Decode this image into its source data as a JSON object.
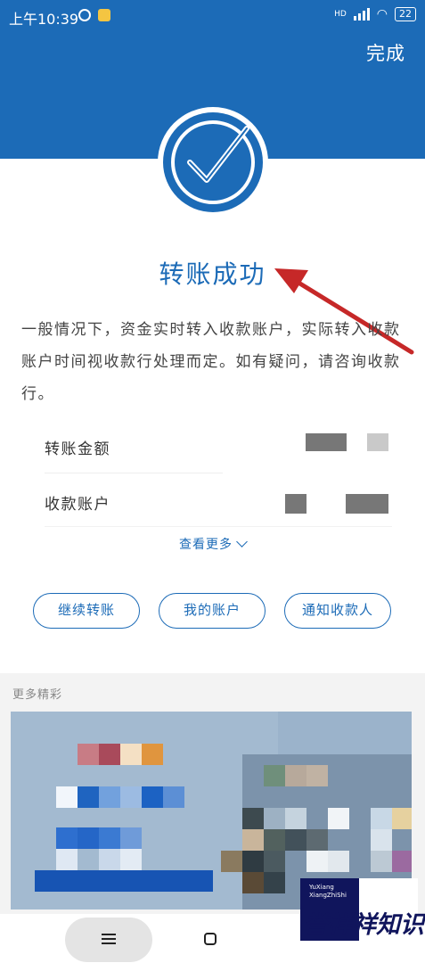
{
  "status_bar": {
    "time": "上午10:39",
    "network": "HD",
    "battery": "22"
  },
  "header": {
    "done_label": "完成",
    "accent_color": "#1c6bb7"
  },
  "result": {
    "title": "转账成功",
    "description": "一般情况下，资金实时转入收款账户，实际转入收款账户时间视收款行处理而定。如有疑问，请咨询收款行。"
  },
  "details": {
    "rows": [
      {
        "label": "转账金额"
      },
      {
        "label": "收款账户"
      }
    ],
    "more_label": "查看更多"
  },
  "actions": [
    {
      "label": "继续转账"
    },
    {
      "label": "我的账户"
    },
    {
      "label": "通知收款人"
    }
  ],
  "section": {
    "title": "更多精彩"
  },
  "watermark": {
    "line1": "YuXiang",
    "line2": "XiangZhiShi",
    "text": "誉祥祥知识"
  }
}
